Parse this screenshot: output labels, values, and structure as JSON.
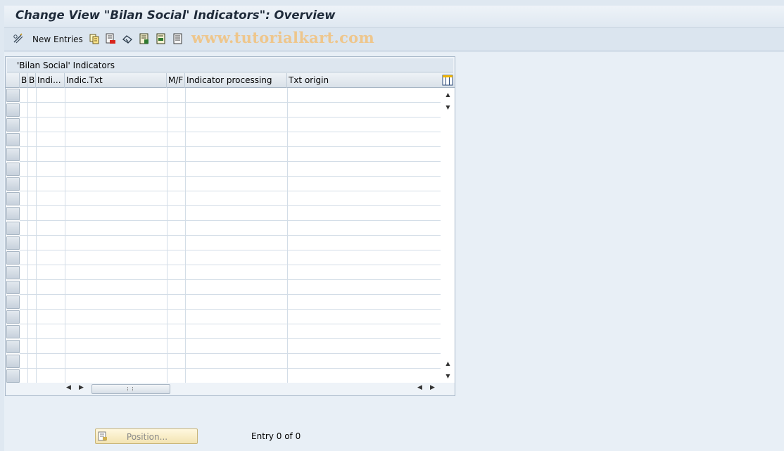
{
  "title": "Change View \"Bilan Social' Indicators\": Overview",
  "toolbar": {
    "new_entries_label": "New Entries",
    "watermark": "www.tutorialkart.com",
    "icons": [
      "edit-glasses-icon",
      "copy-icon",
      "delete-icon",
      "undo-icon",
      "select-all-icon",
      "select-block-icon",
      "deselect-all-icon"
    ]
  },
  "table": {
    "title": "'Bilan Social' Indicators",
    "columns": [
      "B",
      "B",
      "Indi...",
      "Indic.Txt",
      "M/F",
      "Indicator processing",
      "Txt origin"
    ],
    "rows": []
  },
  "footer": {
    "position_label": "Position...",
    "entry_text": "Entry 0 of 0"
  }
}
